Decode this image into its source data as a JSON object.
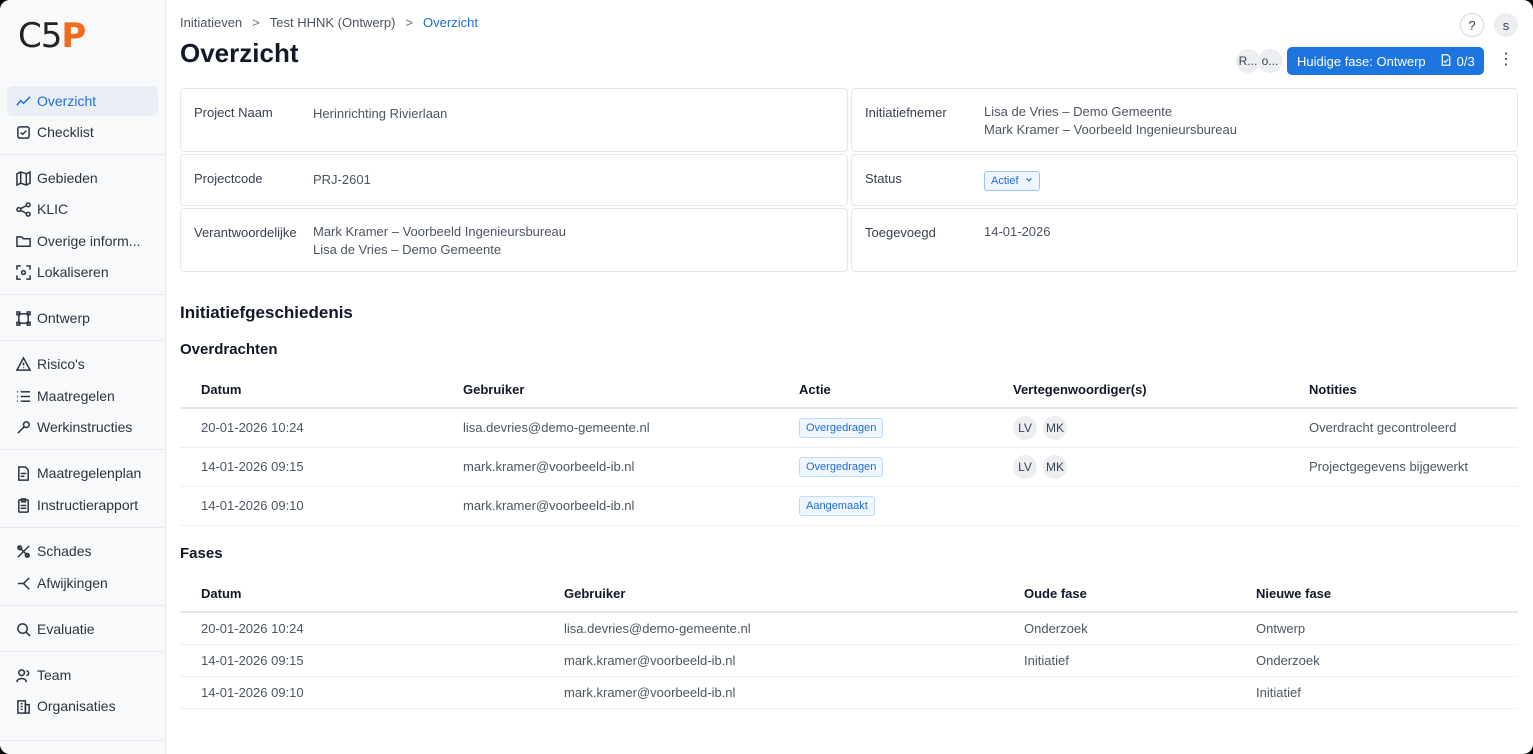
{
  "logo": {
    "c5": "C5",
    "p": "P"
  },
  "sidebar": {
    "items": [
      {
        "label": "Overzicht",
        "icon": "trend-line-icon",
        "active": true
      },
      {
        "label": "Checklist",
        "icon": "checkbox-icon"
      },
      {
        "label": "Gebieden",
        "icon": "map-icon"
      },
      {
        "label": "KLIC",
        "icon": "share-nodes-icon"
      },
      {
        "label": "Overige inform...",
        "icon": "folder-icon"
      },
      {
        "label": "Lokaliseren",
        "icon": "locate-icon"
      },
      {
        "label": "Ontwerp",
        "icon": "design-frame-icon"
      },
      {
        "label": "Risico's",
        "icon": "warning-icon"
      },
      {
        "label": "Maatregelen",
        "icon": "list-icon"
      },
      {
        "label": "Werkinstructies",
        "icon": "wrench-icon"
      },
      {
        "label": "Maatregelenplan",
        "icon": "document-plan-icon"
      },
      {
        "label": "Instructierapport",
        "icon": "clipboard-icon"
      },
      {
        "label": "Schades",
        "icon": "damage-icon"
      },
      {
        "label": "Afwijkingen",
        "icon": "deviation-icon"
      },
      {
        "label": "Evaluatie",
        "icon": "search-icon"
      },
      {
        "label": "Team",
        "icon": "users-icon"
      },
      {
        "label": "Organisaties",
        "icon": "building-icon"
      }
    ]
  },
  "breadcrumb": {
    "items": [
      "Initiatieven",
      "Test HHNK (Ontwerp)",
      "Overzicht"
    ],
    "separator": ">"
  },
  "page": {
    "title": "Overzicht"
  },
  "header": {
    "help": "?",
    "user_initial": "s",
    "avatars": [
      "R...",
      "o..."
    ],
    "phase_button": "Huidige fase: Ontwerp",
    "phase_count": "0/3",
    "more": "⋮"
  },
  "details": {
    "project_name": {
      "label": "Project Naam",
      "value": "Herinrichting Rivierlaan"
    },
    "initiator": {
      "label": "Initiatiefnemer",
      "values": [
        "Lisa de Vries – Demo Gemeente",
        "Mark Kramer – Voorbeeld Ingenieursbureau"
      ]
    },
    "project_code": {
      "label": "Projectcode",
      "value": "PRJ-2601"
    },
    "status": {
      "label": "Status",
      "value": "Actief"
    },
    "responsible": {
      "label": "Verantwoordelijke",
      "values": [
        "Mark Kramer – Voorbeeld Ingenieursbureau",
        "Lisa de Vries – Demo Gemeente"
      ]
    },
    "added": {
      "label": "Toegevoegd",
      "value": "14-01-2026"
    }
  },
  "history": {
    "title": "Initiatiefgeschiedenis",
    "handovers": {
      "title": "Overdrachten",
      "columns": [
        "Datum",
        "Gebruiker",
        "Actie",
        "Vertegenwoordiger(s)",
        "Notities"
      ],
      "rows": [
        {
          "date": "20-01-2026 10:24",
          "user": "lisa.devries@demo-gemeente.nl",
          "action": "Overgedragen",
          "reps": [
            "LV",
            "MK"
          ],
          "note": "Overdracht gecontroleerd"
        },
        {
          "date": "14-01-2026 09:15",
          "user": "mark.kramer@voorbeeld-ib.nl",
          "action": "Overgedragen",
          "reps": [
            "LV",
            "MK"
          ],
          "note": "Projectgegevens bijgewerkt"
        },
        {
          "date": "14-01-2026 09:10",
          "user": "mark.kramer@voorbeeld-ib.nl",
          "action": "Aangemaakt",
          "reps": [],
          "note": ""
        }
      ]
    },
    "phases": {
      "title": "Fases",
      "columns": [
        "Datum",
        "Gebruiker",
        "Oude fase",
        "Nieuwe fase"
      ],
      "rows": [
        {
          "date": "20-01-2026 10:24",
          "user": "lisa.devries@demo-gemeente.nl",
          "old": "Onderzoek",
          "new": "Ontwerp"
        },
        {
          "date": "14-01-2026 09:15",
          "user": "mark.kramer@voorbeeld-ib.nl",
          "old": "Initiatief",
          "new": "Onderzoek"
        },
        {
          "date": "14-01-2026 09:10",
          "user": "mark.kramer@voorbeeld-ib.nl",
          "old": "",
          "new": "Initiatief"
        }
      ]
    }
  },
  "colors": {
    "accent": "#1d75e0",
    "logo_orange": "#f26a1b",
    "active_nav_bg": "#eaeef5"
  }
}
